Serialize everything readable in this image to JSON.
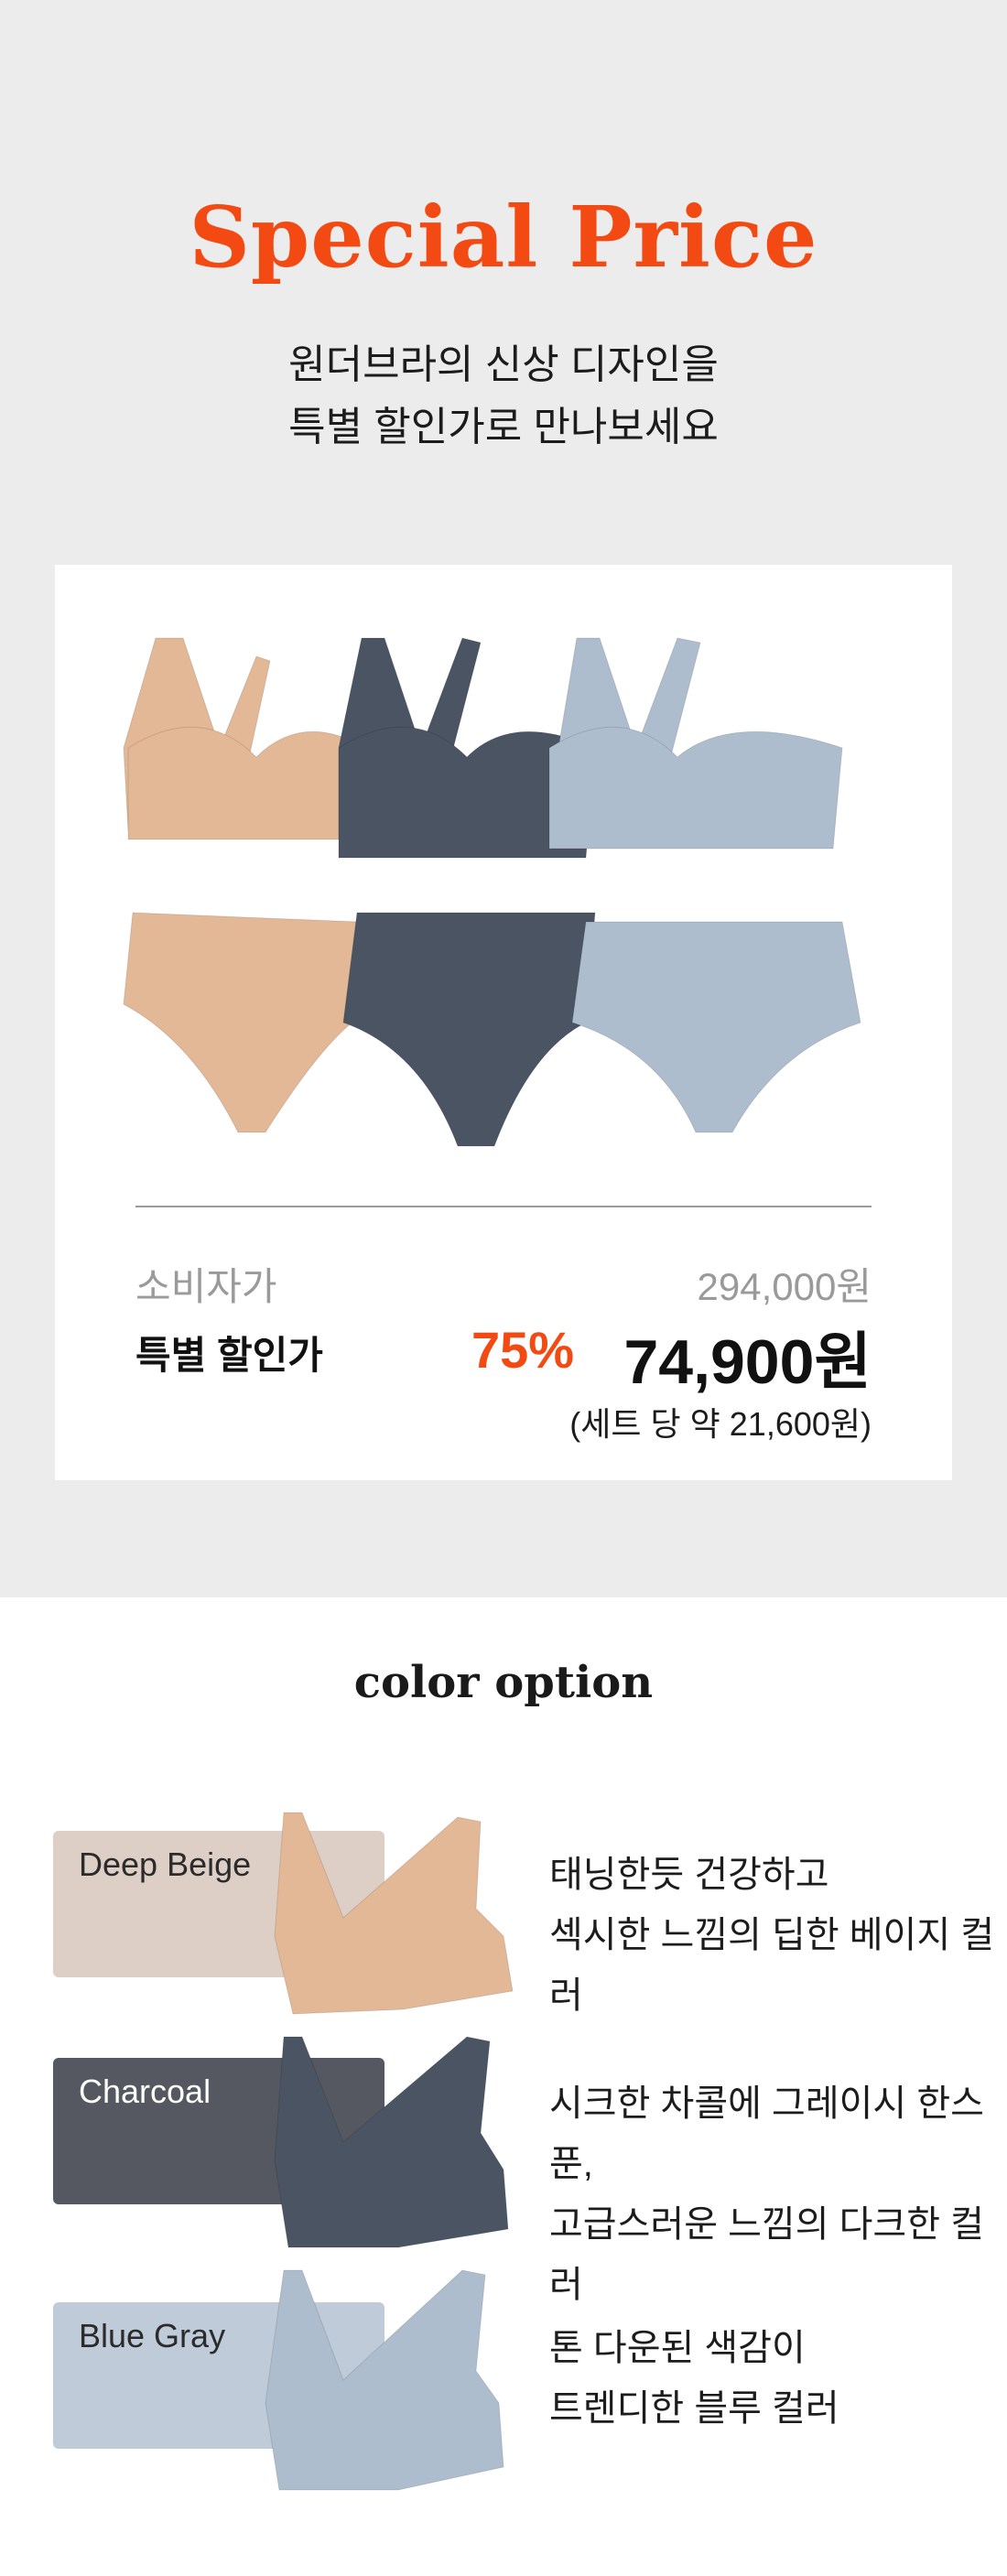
{
  "header": {
    "title": "Special Price",
    "subtitle_line1": "원더브라의 신상 디자인을",
    "subtitle_line2": "특별 할인가로 만나보세요"
  },
  "pricing": {
    "consumer_label": "소비자가",
    "consumer_price": "294,000원",
    "special_label": "특별 할인가",
    "discount": "75%",
    "special_price": "74,900원",
    "per_set_note": "(세트 당 약 21,600원)"
  },
  "colors_section": {
    "title": "color option",
    "options": [
      {
        "name": "Deep Beige",
        "swatch": "#ddcfc6",
        "text_color": "#2b2b2b",
        "bra_color": "#e3b896",
        "line1": "태닝한듯 건강하고",
        "line2": "섹시한 느낌의 딥한 베이지 컬러"
      },
      {
        "name": "Charcoal",
        "swatch": "#555861",
        "text_color": "#ffffff",
        "bra_color": "#4a5462",
        "line1": "시크한 차콜에 그레이시 한스푼,",
        "line2": "고급스러운 느낌의 다크한 컬러"
      },
      {
        "name": "Blue Gray",
        "swatch": "#bfcbd8",
        "text_color": "#2b2b2b",
        "bra_color": "#aebdcd",
        "line1": "톤 다운된 색감이",
        "line2": "트렌디한 블루 컬러"
      }
    ]
  },
  "product_colors": [
    "#e3b896",
    "#4a5462",
    "#aebdcd"
  ]
}
